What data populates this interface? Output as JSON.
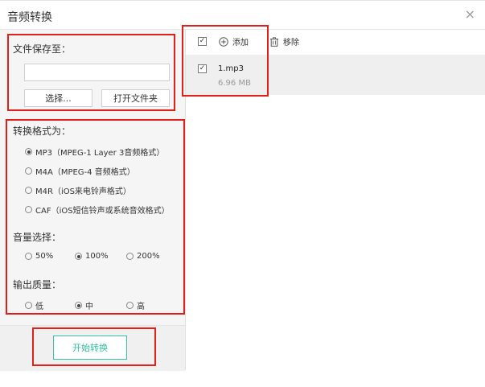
{
  "window": {
    "title": "音频转换",
    "close_glyph": "×"
  },
  "save": {
    "label": "文件保存至：",
    "path_value": "",
    "choose_button": "选择...",
    "open_folder_button": "打开文件夹"
  },
  "format": {
    "label": "转换格式为：",
    "options": [
      {
        "label": "MP3（MPEG-1 Layer 3音频格式）",
        "selected": true
      },
      {
        "label": "M4A（MPEG-4 音频格式）",
        "selected": false
      },
      {
        "label": "M4R（iOS来电铃声格式）",
        "selected": false
      },
      {
        "label": "CAF（iOS短信铃声或系统音效格式）",
        "selected": false
      }
    ]
  },
  "volume": {
    "label": "音量选择：",
    "options": [
      {
        "label": "50%",
        "selected": false
      },
      {
        "label": "100%",
        "selected": true
      },
      {
        "label": "200%",
        "selected": false
      }
    ]
  },
  "quality": {
    "label": "输出质量：",
    "options": [
      {
        "label": "低",
        "selected": false
      },
      {
        "label": "中",
        "selected": true
      },
      {
        "label": "高",
        "selected": false
      }
    ]
  },
  "start_button": "开始转换",
  "toolbar": {
    "select_all_checked": true,
    "add_label": "添加",
    "remove_label": "移除"
  },
  "files": [
    {
      "name": "1.mp3",
      "size": "6.96 MB",
      "checked": true
    }
  ],
  "colors": {
    "highlight_red": "#e0211b",
    "accent_green": "#2fbf9f",
    "panel_gray": "#f5f5f5"
  }
}
